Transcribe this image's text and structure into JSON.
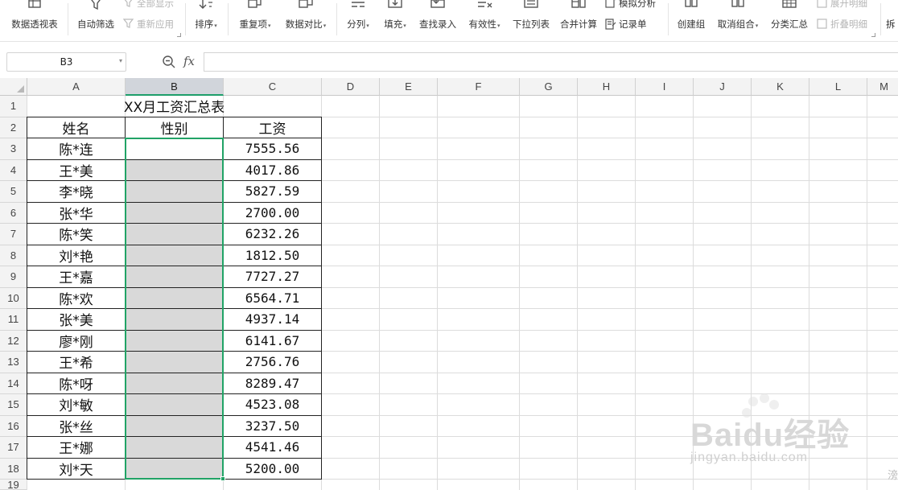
{
  "ribbon": {
    "pivot": "数据透视表",
    "autofilter": "自动筛选",
    "show_all": "全部显示",
    "reapply": "重新应用",
    "sort": "排序",
    "duplicates": "重复项",
    "compare": "数据对比",
    "split": "分列",
    "fill": "填充",
    "lookup": "查找录入",
    "validity": "有效性",
    "dropdown_list": "下拉列表",
    "consolidate": "合并计算",
    "what_if": "模拟分析",
    "record_form": "记录单",
    "group": "创建组",
    "ungroup": "取消组合",
    "subtotal": "分类汇总",
    "expand_detail": "展开明细",
    "collapse_detail": "折叠明细",
    "split_table": "拆"
  },
  "formula_bar": {
    "name_box": "B3",
    "fx_label": "fx",
    "formula": ""
  },
  "columns": [
    "A",
    "B",
    "C",
    "D",
    "E",
    "F",
    "G",
    "H",
    "I",
    "J",
    "K",
    "L",
    "M"
  ],
  "rows": [
    "1",
    "2",
    "3",
    "4",
    "5",
    "6",
    "7",
    "8",
    "9",
    "10",
    "11",
    "12",
    "13",
    "14",
    "15",
    "16",
    "17",
    "18",
    "19"
  ],
  "sheet": {
    "title": "XX月工资汇总表",
    "headers": [
      "姓名",
      "性别",
      "工资"
    ],
    "records": [
      {
        "name": "陈*连",
        "gender": "",
        "salary": "7555.56"
      },
      {
        "name": "王*美",
        "gender": "",
        "salary": "4017.86"
      },
      {
        "name": "李*晓",
        "gender": "",
        "salary": "5827.59"
      },
      {
        "name": "张*华",
        "gender": "",
        "salary": "2700.00"
      },
      {
        "name": "陈*笑",
        "gender": "",
        "salary": "6232.26"
      },
      {
        "name": "刘*艳",
        "gender": "",
        "salary": "1812.50"
      },
      {
        "name": "王*嘉",
        "gender": "",
        "salary": "7727.27"
      },
      {
        "name": "陈*欢",
        "gender": "",
        "salary": "6564.71"
      },
      {
        "name": "张*美",
        "gender": "",
        "salary": "4937.14"
      },
      {
        "name": "廖*刚",
        "gender": "",
        "salary": "6141.67"
      },
      {
        "name": "王*希",
        "gender": "",
        "salary": "2756.76"
      },
      {
        "name": "陈*呀",
        "gender": "",
        "salary": "8289.47"
      },
      {
        "name": "刘*敏",
        "gender": "",
        "salary": "4523.08"
      },
      {
        "name": "张*丝",
        "gender": "",
        "salary": "3237.50"
      },
      {
        "name": "王*娜",
        "gender": "",
        "salary": "4541.46"
      },
      {
        "name": "刘*天",
        "gender": "",
        "salary": "5200.00"
      }
    ]
  },
  "selection": {
    "active_cell": "B3",
    "range": "B3:B18"
  },
  "colors": {
    "selection": "#21a366",
    "selected_fill": "#d9d9d9",
    "header_bg": "#f3f3f3"
  },
  "watermark": {
    "logo": "Baidu经验",
    "url": "jingyan.baidu.com",
    "edge": "滂"
  }
}
